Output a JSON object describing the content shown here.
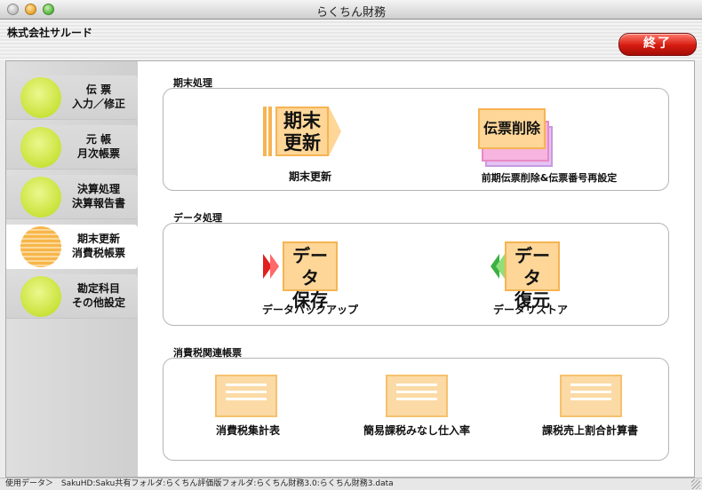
{
  "window": {
    "title": "らくちん財務"
  },
  "header": {
    "company": "株式会社サルード",
    "exit_label": "終了"
  },
  "sidebar": {
    "items": [
      {
        "line1": "伝 票",
        "line2": "入力／修正",
        "active": false
      },
      {
        "line1": "元 帳",
        "line2": "月次帳票",
        "active": false
      },
      {
        "line1": "決算処理",
        "line2": "決算報告書",
        "active": false
      },
      {
        "line1": "期末更新",
        "line2": "消費税帳票",
        "active": true
      },
      {
        "line1": "勘定科目",
        "line2": "その他設定",
        "active": false
      }
    ]
  },
  "sections": {
    "year_end": {
      "label": "期末処理",
      "actions": [
        {
          "icon_text_1": "期末",
          "icon_text_2": "更新",
          "caption": "期末更新"
        },
        {
          "icon_text": "伝票削除",
          "caption": "前期伝票削除&伝票番号再設定"
        }
      ]
    },
    "data": {
      "label": "データ処理",
      "actions": [
        {
          "icon_text_1": "データ",
          "icon_text_2": "保存",
          "caption": "データバックアップ"
        },
        {
          "icon_text_1": "データ",
          "icon_text_2": "復元",
          "caption": "データリストア"
        }
      ]
    },
    "tax": {
      "label": "消費税関連帳票",
      "actions": [
        {
          "caption": "消費税集計表"
        },
        {
          "caption": "簡易課税みなし仕入率"
        },
        {
          "caption": "課税売上割合計算書"
        }
      ]
    }
  },
  "status": {
    "label": "使用データ＞",
    "path": "SakuHD:Saku共有フォルダ:らくちん評価版フォルダ:らくちん財務3.0:らくちん財務3.data"
  },
  "colors": {
    "accent_orange": "#fdd698",
    "exit_red": "#d61b10",
    "nav_green": "#c9e33a",
    "backup_red": "#e02020",
    "restore_green": "#3cb043"
  }
}
